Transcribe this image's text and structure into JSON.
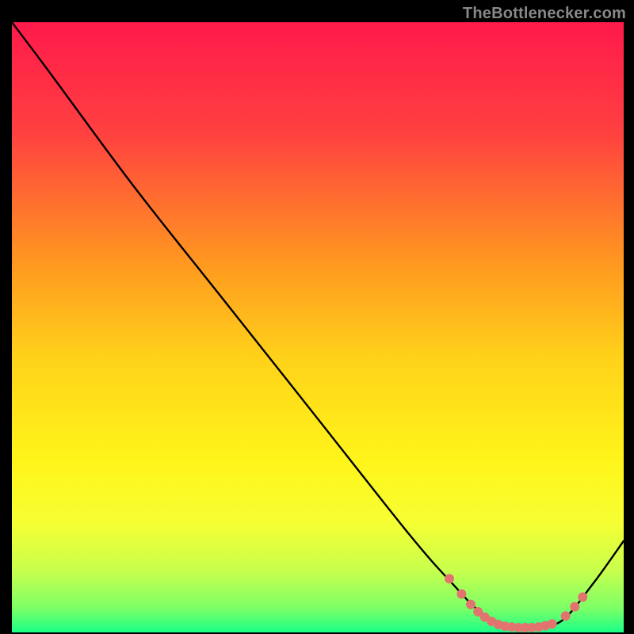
{
  "attribution": "TheBottlenecker.com",
  "chart_data": {
    "type": "line",
    "title": "",
    "xlabel": "",
    "ylabel": "",
    "xlim": [
      0,
      100
    ],
    "ylim": [
      0,
      100
    ],
    "gradient": {
      "stops": [
        {
          "offset": 0,
          "color": "#ff1a4b"
        },
        {
          "offset": 0.18,
          "color": "#ff4040"
        },
        {
          "offset": 0.4,
          "color": "#ff9a1f"
        },
        {
          "offset": 0.55,
          "color": "#ffd21a"
        },
        {
          "offset": 0.72,
          "color": "#fff51a"
        },
        {
          "offset": 0.82,
          "color": "#f6ff33"
        },
        {
          "offset": 0.9,
          "color": "#c7ff4d"
        },
        {
          "offset": 0.96,
          "color": "#7dff66"
        },
        {
          "offset": 1.0,
          "color": "#1aff88"
        }
      ]
    },
    "series": [
      {
        "name": "curve",
        "x": [
          0,
          6,
          20,
          35,
          50,
          65,
          72,
          77,
          82,
          86,
          90,
          95,
          100
        ],
        "y": [
          100,
          92,
          73,
          54,
          35,
          16,
          8,
          3,
          1,
          1,
          2,
          8,
          15
        ]
      }
    ],
    "markers": {
      "color": "#e2736f",
      "radius": 6,
      "points": [
        {
          "x": 71.5,
          "y": 8.8
        },
        {
          "x": 73.5,
          "y": 6.3
        },
        {
          "x": 75.0,
          "y": 4.6
        },
        {
          "x": 76.2,
          "y": 3.4
        },
        {
          "x": 77.3,
          "y": 2.5
        },
        {
          "x": 78.4,
          "y": 1.8
        },
        {
          "x": 79.5,
          "y": 1.3
        },
        {
          "x": 80.6,
          "y": 1.0
        },
        {
          "x": 81.7,
          "y": 0.9
        },
        {
          "x": 82.8,
          "y": 0.8
        },
        {
          "x": 83.9,
          "y": 0.8
        },
        {
          "x": 85.0,
          "y": 0.8
        },
        {
          "x": 86.1,
          "y": 0.9
        },
        {
          "x": 87.2,
          "y": 1.1
        },
        {
          "x": 88.3,
          "y": 1.4
        },
        {
          "x": 90.5,
          "y": 2.7
        },
        {
          "x": 92.0,
          "y": 4.2
        },
        {
          "x": 93.3,
          "y": 5.8
        }
      ]
    }
  }
}
